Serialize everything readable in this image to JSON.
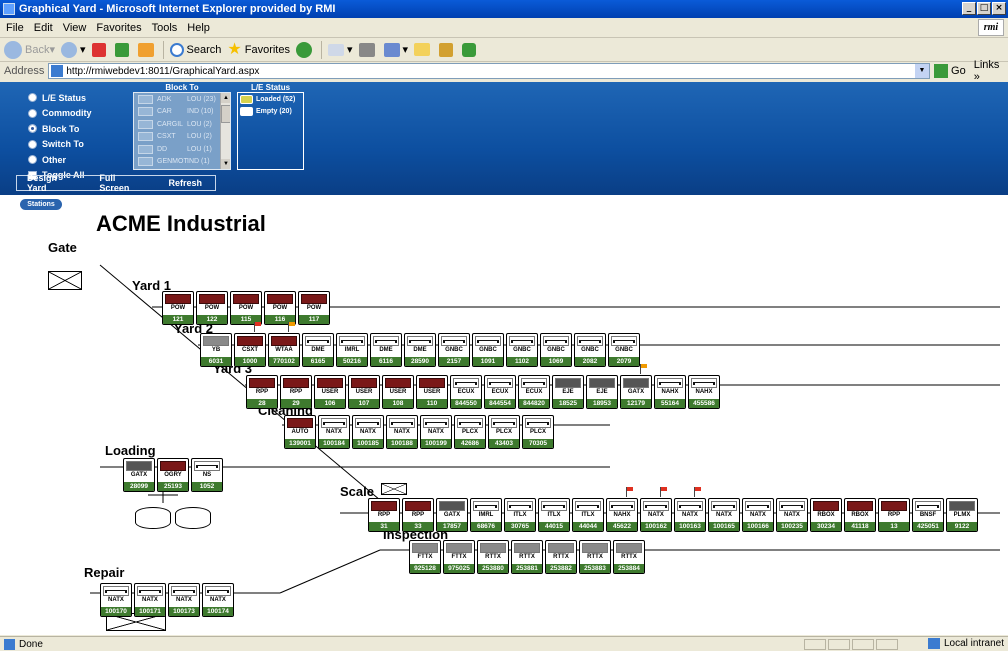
{
  "window": {
    "title": "Graphical Yard - Microsoft Internet Explorer provided by RMI",
    "controls": [
      "_",
      "□",
      "×"
    ]
  },
  "menu": [
    "File",
    "Edit",
    "View",
    "Favorites",
    "Tools",
    "Help"
  ],
  "brand": "rmi",
  "toolbar": {
    "back": "Back",
    "search": "Search",
    "favorites": "Favorites"
  },
  "address": {
    "label": "Address",
    "url": "http://rmiwebdev1:8011/GraphicalYard.aspx",
    "go": "Go",
    "links": "Links »"
  },
  "panel": {
    "options": [
      {
        "label": "L/E Status",
        "kind": "radio",
        "selected": false
      },
      {
        "label": "Commodity",
        "kind": "radio",
        "selected": false
      },
      {
        "label": "Block To",
        "kind": "radio",
        "selected": true
      },
      {
        "label": "Switch To",
        "kind": "radio",
        "selected": false
      },
      {
        "label": "Other",
        "kind": "radio",
        "selected": false
      },
      {
        "label": "Toggle All",
        "kind": "checkbox",
        "selected": false
      }
    ],
    "block_to_title": "Block To",
    "block_to": [
      {
        "name": "ADK",
        "dest": "LOU (23)"
      },
      {
        "name": "CAR",
        "dest": "IND (10)"
      },
      {
        "name": "CARGIL",
        "dest": "LOU (2)"
      },
      {
        "name": "CSXT",
        "dest": "LOU (2)"
      },
      {
        "name": "DD",
        "dest": "LOU (1)"
      },
      {
        "name": "GENMOT",
        "dest": "IND (1)"
      }
    ],
    "le_status_title": "L/E Status",
    "le_status": [
      {
        "label": "Loaded (52)",
        "color": "#d7d24e"
      },
      {
        "label": "Empty (20)",
        "color": "#ffffff"
      }
    ],
    "actions": [
      "Design Yard",
      "Full Screen",
      "Refresh"
    ]
  },
  "main": {
    "stations_tab": "Stations",
    "title": "ACME Industrial",
    "sections": {
      "gate": "Gate",
      "yard1": "Yard 1",
      "yard2": "Yard 2",
      "yard3": "Yard 3",
      "cleaning": "Cleaning",
      "loading": "Loading",
      "scale": "Scale",
      "inspection": "Inspection",
      "repair": "Repair"
    },
    "tracks": {
      "yard1": [
        {
          "owner": "POW",
          "num": "121",
          "img": "loaded"
        },
        {
          "owner": "POW",
          "num": "122",
          "img": "loaded"
        },
        {
          "owner": "POW",
          "num": "115",
          "img": "loaded"
        },
        {
          "owner": "POW",
          "num": "116",
          "img": "loaded"
        },
        {
          "owner": "POW",
          "num": "117",
          "img": "loaded"
        }
      ],
      "yard2": [
        {
          "owner": "YB",
          "num": "6031",
          "img": "gray"
        },
        {
          "owner": "CSXT",
          "num": "1000",
          "img": "loaded",
          "flag": "red"
        },
        {
          "owner": "WTAA",
          "num": "770102",
          "img": "loaded",
          "flag": "orange"
        },
        {
          "owner": "DME",
          "num": "6165",
          "img": "hoppers"
        },
        {
          "owner": "IMRL",
          "num": "50216",
          "img": "hoppers"
        },
        {
          "owner": "DME",
          "num": "6116",
          "img": "hoppers"
        },
        {
          "owner": "DME",
          "num": "28590",
          "img": "hoppers"
        },
        {
          "owner": "GNBC",
          "num": "2157",
          "img": "hoppers"
        },
        {
          "owner": "GNBC",
          "num": "1091",
          "img": "hoppers"
        },
        {
          "owner": "GNBC",
          "num": "1102",
          "img": "hoppers"
        },
        {
          "owner": "GNBC",
          "num": "1069",
          "img": "hoppers"
        },
        {
          "owner": "GNBC",
          "num": "2082",
          "img": "hoppers"
        },
        {
          "owner": "GNBC",
          "num": "2079",
          "img": "hoppers"
        }
      ],
      "yard3": [
        {
          "owner": "RPP",
          "num": "28",
          "img": "loaded"
        },
        {
          "owner": "RPP",
          "num": "29",
          "img": "loaded"
        },
        {
          "owner": "USER",
          "num": "106",
          "img": "loaded"
        },
        {
          "owner": "USER",
          "num": "107",
          "img": "loaded"
        },
        {
          "owner": "USER",
          "num": "108",
          "img": "loaded"
        },
        {
          "owner": "USER",
          "num": "110",
          "img": "loaded"
        },
        {
          "owner": "ECUX",
          "num": "844550",
          "img": "hoppers"
        },
        {
          "owner": "ECUX",
          "num": "844554",
          "img": "hoppers"
        },
        {
          "owner": "ECUX",
          "num": "844820",
          "img": "hoppers"
        },
        {
          "owner": "EJE",
          "num": "18525",
          "img": "dark"
        },
        {
          "owner": "EJE",
          "num": "18953",
          "img": "dark"
        },
        {
          "owner": "GATX",
          "num": "12179",
          "img": "dark",
          "flag": "orange"
        },
        {
          "owner": "NAHX",
          "num": "55164",
          "img": "hoppers"
        },
        {
          "owner": "NAHX",
          "num": "455586",
          "img": "hoppers"
        }
      ],
      "cleaning": [
        {
          "owner": "AUTO",
          "num": "139001",
          "img": "loaded"
        },
        {
          "owner": "NATX",
          "num": "100184",
          "img": "hoppers"
        },
        {
          "owner": "NATX",
          "num": "100185",
          "img": "hoppers"
        },
        {
          "owner": "NATX",
          "num": "100188",
          "img": "hoppers"
        },
        {
          "owner": "NATX",
          "num": "100199",
          "img": "hoppers"
        },
        {
          "owner": "PLCX",
          "num": "42686",
          "img": "hoppers"
        },
        {
          "owner": "PLCX",
          "num": "43403",
          "img": "hoppers"
        },
        {
          "owner": "PLCX",
          "num": "70305",
          "img": "hoppers"
        }
      ],
      "loading": [
        {
          "owner": "GATX",
          "num": "28099",
          "img": "dark"
        },
        {
          "owner": "OGRY",
          "num": "25193",
          "img": "loaded"
        },
        {
          "owner": "NS",
          "num": "1052",
          "img": "hoppers"
        }
      ],
      "scale": [
        {
          "owner": "RPP",
          "num": "31",
          "img": "loaded"
        },
        {
          "owner": "RPP",
          "num": "33",
          "img": "loaded"
        },
        {
          "owner": "GATX",
          "num": "17857",
          "img": "dark"
        },
        {
          "owner": "IMRL",
          "num": "68676",
          "img": "hoppers"
        },
        {
          "owner": "ITLX",
          "num": "30765",
          "img": "hoppers"
        },
        {
          "owner": "ITLX",
          "num": "44015",
          "img": "hoppers"
        },
        {
          "owner": "ITLX",
          "num": "44044",
          "img": "hoppers"
        },
        {
          "owner": "NAHX",
          "num": "45622",
          "img": "hoppers",
          "flag": "red"
        },
        {
          "owner": "NATX",
          "num": "100162",
          "img": "hoppers",
          "flag": "red"
        },
        {
          "owner": "NATX",
          "num": "100163",
          "img": "hoppers",
          "flag": "red"
        },
        {
          "owner": "NATX",
          "num": "100165",
          "img": "hoppers"
        },
        {
          "owner": "NATX",
          "num": "100166",
          "img": "hoppers"
        },
        {
          "owner": "NATX",
          "num": "100235",
          "img": "hoppers"
        },
        {
          "owner": "RBOX",
          "num": "30234",
          "img": "loaded"
        },
        {
          "owner": "RBOX",
          "num": "41118",
          "img": "loaded"
        },
        {
          "owner": "RPP",
          "num": "13",
          "img": "loaded"
        },
        {
          "owner": "BNSF",
          "num": "425051",
          "img": "hoppers"
        },
        {
          "owner": "PLMX",
          "num": "9122",
          "img": "dark"
        }
      ],
      "inspection": [
        {
          "owner": "FTTX",
          "num": "925128",
          "img": "gray"
        },
        {
          "owner": "FTTX",
          "num": "975025",
          "img": "gray"
        },
        {
          "owner": "RTTX",
          "num": "253880",
          "img": "gray"
        },
        {
          "owner": "RTTX",
          "num": "253881",
          "img": "gray"
        },
        {
          "owner": "RTTX",
          "num": "253882",
          "img": "gray"
        },
        {
          "owner": "RTTX",
          "num": "253883",
          "img": "gray"
        },
        {
          "owner": "RTTX",
          "num": "253884",
          "img": "gray"
        }
      ],
      "repair": [
        {
          "owner": "NATX",
          "num": "100170",
          "img": "hoppers"
        },
        {
          "owner": "NATX",
          "num": "100171",
          "img": "hoppers"
        },
        {
          "owner": "NATX",
          "num": "100173",
          "img": "hoppers"
        },
        {
          "owner": "NATX",
          "num": "100174",
          "img": "hoppers"
        }
      ]
    }
  },
  "status": {
    "text": "Done",
    "zone": "Local intranet"
  }
}
